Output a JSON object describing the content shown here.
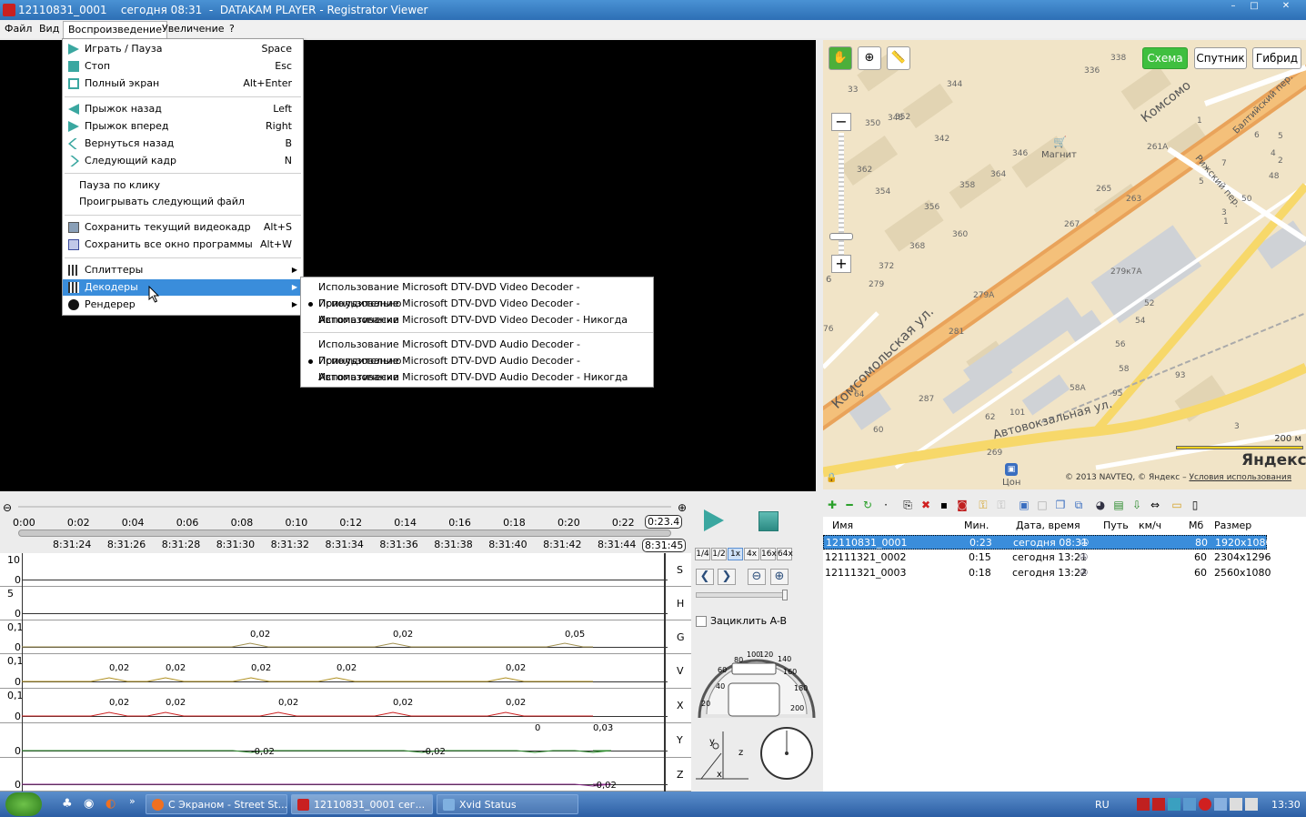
{
  "window": {
    "title": "12110831_0001    сегодня 08:31  -  DATAKAM PLAYER - Registrator Viewer",
    "controls": [
      "–",
      "□",
      "✕"
    ]
  },
  "menubar": {
    "items": [
      "Файл",
      "Вид",
      "Воспроизведение",
      "Увеличение",
      "?"
    ]
  },
  "playback_menu": {
    "items": [
      {
        "label": "Играть / Пауза",
        "shortcut": "Space",
        "icon": "play-icon"
      },
      {
        "label": "Стоп",
        "shortcut": "Esc",
        "icon": "stop-icon"
      },
      {
        "label": "Полный экран",
        "shortcut": "Alt+Enter",
        "icon": "fullscreen-icon"
      },
      {
        "label": "Прыжок назад",
        "shortcut": "Left",
        "icon": "jump-back-icon"
      },
      {
        "label": "Прыжок вперед",
        "shortcut": "Right",
        "icon": "jump-forward-icon"
      },
      {
        "label": "Вернуться назад",
        "shortcut": "B",
        "icon": "back-icon"
      },
      {
        "label": "Следующий кадр",
        "shortcut": "N",
        "icon": "next-frame-icon"
      },
      {
        "label": "Пауза по клику",
        "shortcut": ""
      },
      {
        "label": "Проигрывать следующий файл",
        "shortcut": ""
      },
      {
        "label": "Сохранить текущий видеокадр",
        "shortcut": "Alt+S",
        "icon": "save-frame-icon"
      },
      {
        "label": "Сохранить все окно программы",
        "shortcut": "Alt+W",
        "icon": "save-window-icon"
      },
      {
        "label": "Сплиттеры",
        "shortcut": "",
        "icon": "codec-icon"
      },
      {
        "label": "Декодеры",
        "shortcut": "",
        "icon": "codec-icon"
      },
      {
        "label": "Рендерер",
        "shortcut": "",
        "icon": "eye-icon"
      }
    ]
  },
  "decoders_submenu": {
    "items": [
      {
        "label": "Использование Microsoft DTV-DVD Video Decoder - Принудительно",
        "checked": false
      },
      {
        "label": "Использование Microsoft DTV-DVD Video Decoder - Автоматически",
        "checked": true
      },
      {
        "label": "Использование Microsoft DTV-DVD Video Decoder - Никогда",
        "checked": false
      },
      {
        "label": "Использование Microsoft DTV-DVD Audio Decoder - Принудительно",
        "checked": false
      },
      {
        "label": "Использование Microsoft DTV-DVD Audio Decoder - Автоматически",
        "checked": true
      },
      {
        "label": "Использование Microsoft DTV-DVD Audio Decoder - Никогда",
        "checked": false
      }
    ]
  },
  "timeline": {
    "durations": [
      "0:00",
      "0:02",
      "0:04",
      "0:06",
      "0:08",
      "0:10",
      "0:12",
      "0:14",
      "0:16",
      "0:18",
      "0:20",
      "0:22"
    ],
    "duration_end": "0:23.4",
    "clock": [
      "8:31:24",
      "8:31:26",
      "8:31:28",
      "8:31:30",
      "8:31:32",
      "8:31:34",
      "8:31:36",
      "8:31:38",
      "8:31:40",
      "8:31:42",
      "8:31:44"
    ],
    "clock_end": "8:31:45"
  },
  "graphs": [
    {
      "channel": "S",
      "top": "10",
      "bottom": "0",
      "labels": []
    },
    {
      "channel": "H",
      "top": "5",
      "bottom": "0",
      "labels": []
    },
    {
      "channel": "G",
      "top": "0,1",
      "bottom": "0",
      "labels": [
        "0,02",
        "0,02",
        "0,05"
      ],
      "color": "#a09050"
    },
    {
      "channel": "V",
      "top": "0,1",
      "bottom": "0",
      "labels": [
        "0,02",
        "0,02",
        "0,02",
        "0,02",
        "0,02"
      ],
      "color": "#b09020"
    },
    {
      "channel": "X",
      "top": "0,1",
      "bottom": "0",
      "labels": [
        "0,02",
        "0,02",
        "0,02",
        "0,02",
        "0,02"
      ],
      "color": "#cc2020"
    },
    {
      "channel": "Y",
      "top": "",
      "bottom": "0",
      "labels": [
        "-0,02",
        "-0,02",
        "0",
        "0,03"
      ],
      "color": "#2a8a2a"
    },
    {
      "channel": "Z",
      "top": "",
      "bottom": "0",
      "labels": [
        "-0,02"
      ],
      "color": "#8a2a8a"
    }
  ],
  "controls": {
    "speeds": [
      "1/4",
      "1/2",
      "1x",
      "4x",
      "16x",
      "64x"
    ],
    "selected_speed": "1x",
    "loop_label": "Зациклить A-B",
    "speedo_ticks": [
      "20",
      "40",
      "60",
      "80",
      "100",
      "120",
      "140",
      "160",
      "180",
      "200"
    ],
    "axis_labels": [
      "y",
      "z",
      "x"
    ]
  },
  "map": {
    "tabs": [
      "Схема",
      "Спутник",
      "Гибрид"
    ],
    "active_tab": "Схема",
    "streets": [
      "Комсомольская ул.",
      "Комсомо",
      "Автовокзальная ул.",
      "Рижский пер.",
      "Балтийский пер."
    ],
    "pois": [
      "Магнит",
      "Цон"
    ],
    "house_numbers": [
      "338",
      "336",
      "344",
      "352",
      "33",
      "350",
      "348",
      "342",
      "346",
      "364",
      "362",
      "354",
      "358",
      "356",
      "360",
      "368",
      "372",
      "279",
      "279А",
      "281",
      "287",
      "64",
      "60",
      "62",
      "101",
      "269",
      "267",
      "265",
      "263",
      "261А",
      "1",
      "7",
      "5",
      "3",
      "1",
      "279к7А",
      "52",
      "54",
      "56",
      "58",
      "58А",
      "93",
      "95",
      "3",
      "50",
      "48",
      "4",
      "6",
      "5",
      "2"
    ],
    "scale": "200 м",
    "copyright": "© 2013 NAVTEQ, © Яндекс – ",
    "terms_link": "Условия использования",
    "logo": "Яндекс",
    "left_edge": [
      "6",
      "76"
    ]
  },
  "files": {
    "columns": [
      "Имя",
      "Мин.",
      "Дата, время",
      "Путь",
      "км/ч",
      "Мб",
      "Размер"
    ],
    "rows": [
      {
        "name": "12110831_0001",
        "min": "0:23",
        "datetime": "сегодня 08:31",
        "mb": "80",
        "size": "1920x1080"
      },
      {
        "name": "12111321_0002",
        "min": "0:15",
        "datetime": "сегодня 13:21",
        "mb": "60",
        "size": "2304x1296"
      },
      {
        "name": "12111321_0003",
        "min": "0:18",
        "datetime": "сегодня 13:22",
        "mb": "60",
        "size": "2560x1080"
      }
    ]
  },
  "taskbar": {
    "tasks": [
      "С Экраном - Street St...",
      "12110831_0001    сег...",
      "Xvid Status"
    ],
    "language": "RU",
    "time": "13:30"
  },
  "colors": {
    "accent": "#3a8ddb",
    "map_bg": "#f1e4c7",
    "road_orange": "#f4a64a",
    "road_yellow": "#f7d86a",
    "map_active": "#3fbf3f"
  }
}
